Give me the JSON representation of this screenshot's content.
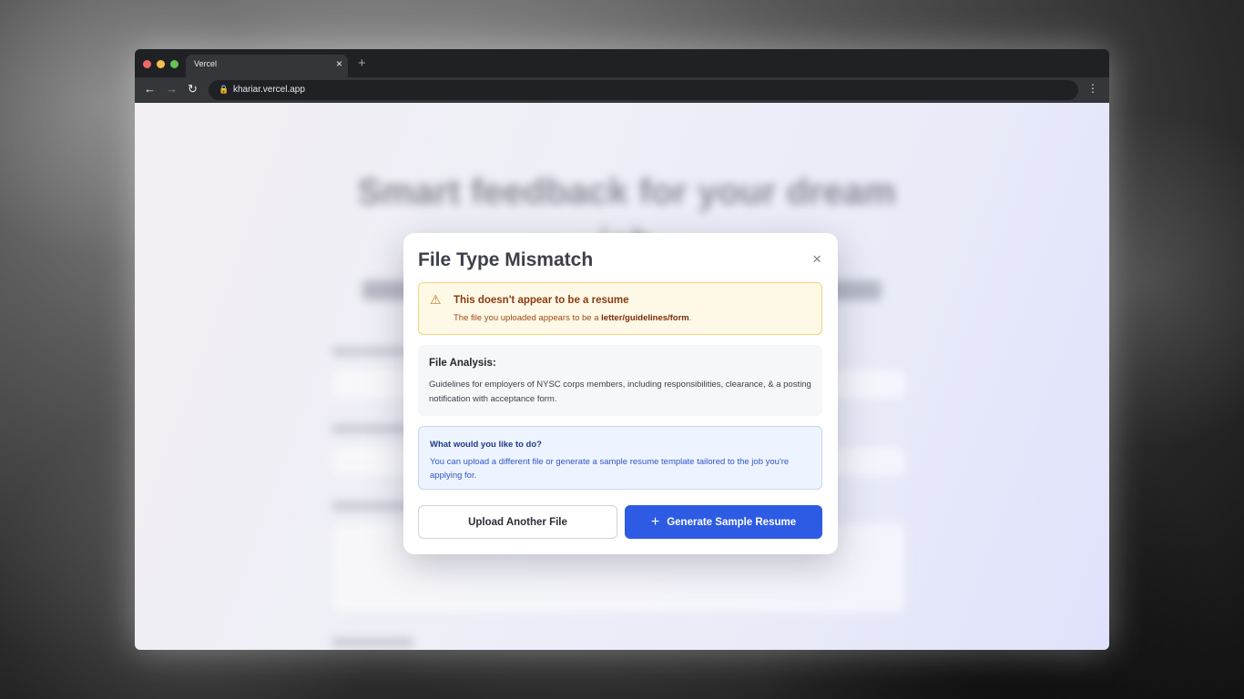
{
  "browser": {
    "tab_title": "Vercel",
    "tab_close": "×",
    "new_tab": "+",
    "url": "khariar.vercel.app",
    "lock_icon": "🔒",
    "back": "←",
    "forward": "→",
    "reload": "↻",
    "menu": "⋮",
    "traffic_colors": [
      "#ee6a5f",
      "#f5be4f",
      "#62c554"
    ]
  },
  "background": {
    "title": "Smart feedback for your dream job"
  },
  "modal": {
    "title": "File Type Mismatch",
    "close": "×",
    "warning": {
      "icon": "⚠",
      "heading": "This doesn't appear to be a resume",
      "body_prefix": "The file you uploaded appears to be a ",
      "body_type": "letter/guidelines/form",
      "body_suffix": "."
    },
    "analysis": {
      "heading": "File Analysis:",
      "body": "Guidelines for employers of NYSC corps members, including responsibilities, clearance, & a posting notification with acceptance form."
    },
    "info": {
      "heading": "What would you like to do?",
      "body": "You can upload a different file or generate a sample resume template tailored to the job you're applying for."
    },
    "buttons": {
      "upload": "Upload Another File",
      "generate": "Generate Sample Resume",
      "generate_icon": "+"
    }
  },
  "colors": {
    "primary": "#2d5be3",
    "warning_bg": "#fef9e7",
    "info_bg": "#eef4ff"
  }
}
